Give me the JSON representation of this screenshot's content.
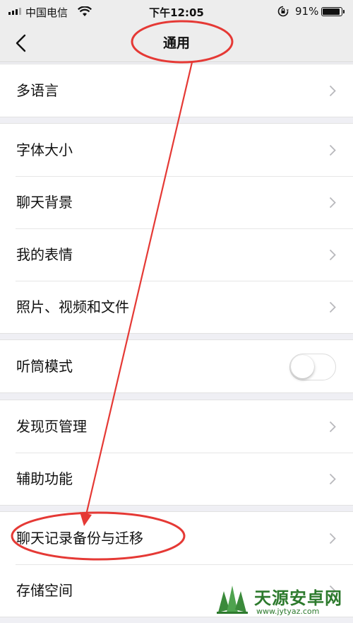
{
  "status_bar": {
    "carrier": "中国电信",
    "time": "下午12:05",
    "battery": "91%",
    "battery_level": 0.91,
    "icons": [
      "signal-icon",
      "wifi-icon",
      "orientation-lock-icon",
      "battery-icon"
    ]
  },
  "nav": {
    "title": "通用",
    "back_icon": "chevron-left-icon"
  },
  "groups": [
    {
      "items": [
        {
          "label": "多语言",
          "control": "chevron"
        }
      ]
    },
    {
      "items": [
        {
          "label": "字体大小",
          "control": "chevron"
        },
        {
          "label": "聊天背景",
          "control": "chevron"
        },
        {
          "label": "我的表情",
          "control": "chevron"
        },
        {
          "label": "照片、视频和文件",
          "control": "chevron"
        }
      ]
    },
    {
      "items": [
        {
          "label": "听筒模式",
          "control": "toggle",
          "on": false
        }
      ]
    },
    {
      "items": [
        {
          "label": "发现页管理",
          "control": "chevron"
        },
        {
          "label": "辅助功能",
          "control": "chevron"
        }
      ]
    },
    {
      "items": [
        {
          "label": "聊天记录备份与迁移",
          "control": "chevron"
        },
        {
          "label": "存储空间",
          "control": "chevron"
        }
      ]
    }
  ],
  "annotation": {
    "color": "#e53935",
    "highlighted": [
      "通用",
      "聊天记录备份与迁移"
    ]
  },
  "watermark": {
    "title": "天源安卓网",
    "url": "www.jytyaz.com",
    "color": "#2d7a2d"
  }
}
